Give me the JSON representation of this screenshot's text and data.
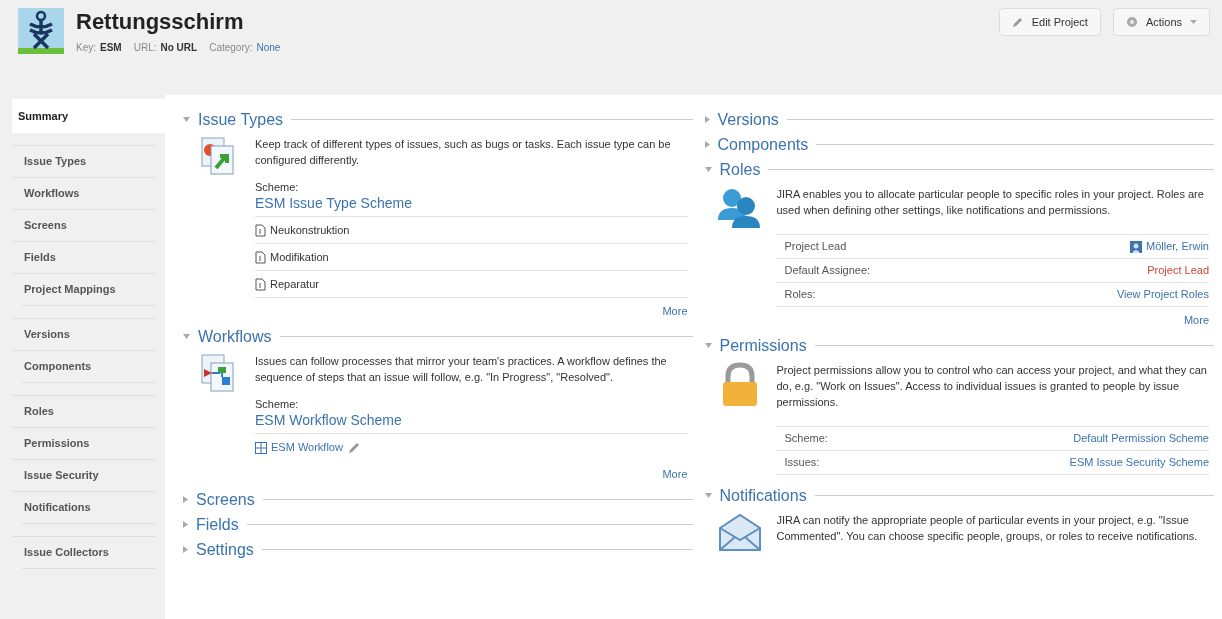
{
  "header": {
    "title": "Rettungsschirm",
    "meta": [
      {
        "label": "Key:",
        "value": "ESM",
        "kind": "bold"
      },
      {
        "label": "URL:",
        "value": "No URL",
        "kind": "bold"
      },
      {
        "label": "Category:",
        "value": "None",
        "kind": "link"
      }
    ],
    "buttons": [
      {
        "label": "Edit Project",
        "kind": "edit"
      },
      {
        "label": "Actions",
        "kind": "menu"
      }
    ]
  },
  "sidebar": {
    "groups": [
      [
        {
          "label": "Summary",
          "selected": true
        }
      ],
      [
        {
          "label": "Issue Types",
          "selected": false
        },
        {
          "label": "Workflows",
          "selected": false
        },
        {
          "label": "Screens",
          "selected": false
        },
        {
          "label": "Fields",
          "selected": false
        },
        {
          "label": "Project Mappings",
          "selected": false
        }
      ],
      [
        {
          "label": "Versions",
          "selected": false
        },
        {
          "label": "Components",
          "selected": false
        }
      ],
      [
        {
          "label": "Roles",
          "selected": false
        },
        {
          "label": "Permissions",
          "selected": false
        },
        {
          "label": "Issue Security",
          "selected": false
        },
        {
          "label": "Notifications",
          "selected": false
        }
      ],
      [
        {
          "label": "Issue Collectors",
          "selected": false
        }
      ]
    ]
  },
  "columns": [
    [
      {
        "title": "Issue Types",
        "expanded": true,
        "kind": "issue-types",
        "description": "Keep track of different types of issues, such as bugs or tasks. Each issue type can be configured differently.",
        "scheme_label": "Scheme:",
        "scheme": "ESM Issue Type Scheme",
        "items": [
          {
            "label": "Neukonstruktion",
            "kind": "issue-type"
          },
          {
            "label": "Modifikation",
            "kind": "issue-type"
          },
          {
            "label": "Reparatur",
            "kind": "issue-type"
          }
        ],
        "more": "More"
      },
      {
        "title": "Workflows",
        "expanded": true,
        "kind": "workflows",
        "description": "Issues can follow processes that mirror your team's practices. A workflow defines the sequence of steps that an issue will follow, e.g. \"In Progress\", \"Resolved\".",
        "scheme_label": "Scheme:",
        "scheme": "ESM Workflow Scheme",
        "items": [
          {
            "label": "ESM Workflow",
            "kind": "workflow"
          }
        ],
        "more": "More"
      },
      {
        "title": "Screens",
        "expanded": false
      },
      {
        "title": "Fields",
        "expanded": false
      },
      {
        "title": "Settings",
        "expanded": false
      }
    ],
    [
      {
        "title": "Versions",
        "expanded": false
      },
      {
        "title": "Components",
        "expanded": false
      },
      {
        "title": "Roles",
        "expanded": true,
        "kind": "roles",
        "description": "JIRA enables you to allocate particular people to specific roles in your project. Roles are used when defining other settings, like notifications and permissions.",
        "rows": [
          {
            "label": "Project Lead",
            "value": "Möller, Erwin",
            "kind": "user"
          },
          {
            "label": "Default Assignee:",
            "value": "Project Lead",
            "kind": "warning"
          },
          {
            "label": "Roles:",
            "value": "View Project Roles",
            "kind": "link"
          }
        ],
        "more": "More"
      },
      {
        "title": "Permissions",
        "expanded": true,
        "kind": "permissions",
        "description": "Project permissions allow you to control who can access your project, and what they can do, e.g. \"Work on Issues\". Access to individual issues is granted to people by issue permissions.",
        "rows": [
          {
            "label": "Scheme:",
            "value": "Default Permission Scheme",
            "kind": "link"
          },
          {
            "label": "Issues:",
            "value": "ESM Issue Security Scheme",
            "kind": "link"
          }
        ]
      },
      {
        "title": "Notifications",
        "expanded": true,
        "kind": "notifications",
        "description": "JIRA can notify the appropriate people of particular events in your project, e.g. \"Issue Commented\". You can choose specific people, groups, or roles to receive notifications."
      }
    ]
  ]
}
